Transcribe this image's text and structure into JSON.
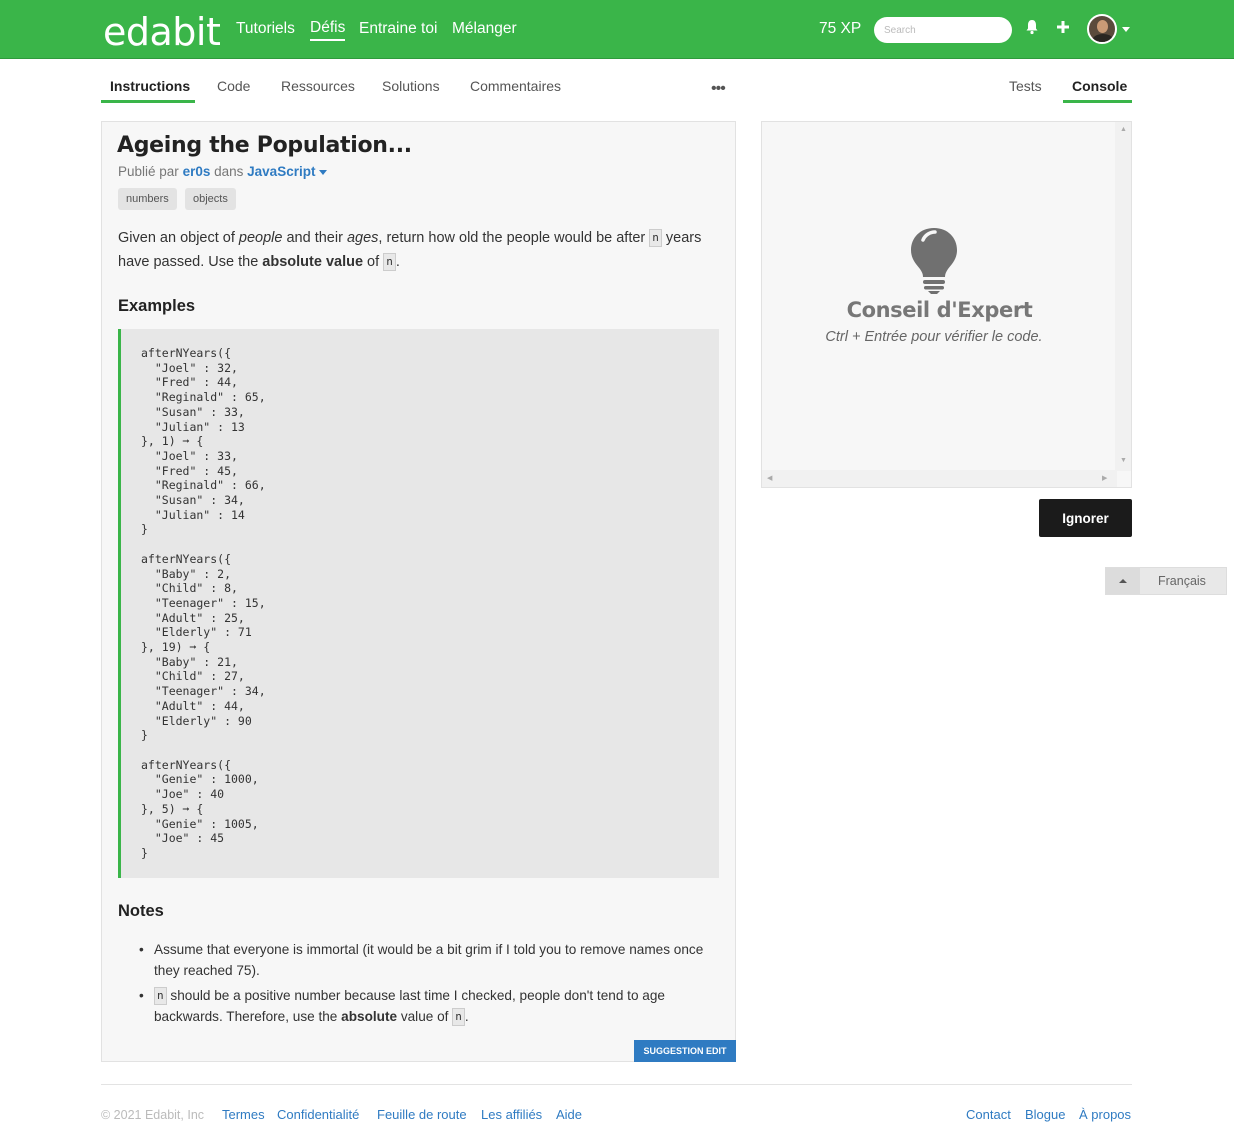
{
  "header": {
    "logo": "edabit",
    "nav": [
      "Tutoriels",
      "Défis",
      "Entraine toi",
      "Mélanger"
    ],
    "active_nav": "Défis",
    "xp": "75 XP",
    "search_placeholder": "Search"
  },
  "tabs": {
    "left": [
      "Instructions",
      "Code",
      "Ressources",
      "Solutions",
      "Commentaires"
    ],
    "more": "•••",
    "right": [
      "Tests",
      "Console"
    ]
  },
  "challenge": {
    "title": "Ageing the Population...",
    "published_prefix": "Publié par",
    "author": "er0s",
    "in_word": "dans",
    "language": "JavaScript",
    "tags": [
      "numbers",
      "objects"
    ],
    "desc": {
      "p1": "Given an object of ",
      "people": "people",
      "p2": " and their ",
      "ages": "ages",
      "p3": ", return how old the people would be after ",
      "n": "n",
      "p4": " years have passed. Use the ",
      "abs": "absolute value",
      "p5": " of ",
      "p6": "."
    },
    "examples_heading": "Examples",
    "code": "afterNYears({\n  \"Joel\" : 32,\n  \"Fred\" : 44,\n  \"Reginald\" : 65,\n  \"Susan\" : 33,\n  \"Julian\" : 13\n}, 1) ➞ {\n  \"Joel\" : 33,\n  \"Fred\" : 45,\n  \"Reginald\" : 66,\n  \"Susan\" : 34,\n  \"Julian\" : 14\n}\n\nafterNYears({\n  \"Baby\" : 2,\n  \"Child\" : 8,\n  \"Teenager\" : 15,\n  \"Adult\" : 25,\n  \"Elderly\" : 71\n}, 19) ➞ {\n  \"Baby\" : 21,\n  \"Child\" : 27,\n  \"Teenager\" : 34,\n  \"Adult\" : 44,\n  \"Elderly\" : 90\n}\n\nafterNYears({\n  \"Genie\" : 1000,\n  \"Joe\" : 40\n}, 5) ➞ {\n  \"Genie\" : 1005,\n  \"Joe\" : 45\n}",
    "notes_heading": "Notes",
    "note1": "Assume that everyone is immortal (it would be a bit grim if I told you to remove names once they reached 75).",
    "note2": {
      "n": "n",
      "a": " should be a positive number because last time I checked, people don't tend to age backwards. Therefore, use the ",
      "abs": "absolute",
      "b": " value of ",
      "c": "."
    },
    "suggest_button": "SUGGESTION EDIT"
  },
  "console": {
    "tip_title": "Conseil d'Expert",
    "tip_text": "Ctrl + Entrée pour vérifier le code.",
    "ignore_button": "Ignorer"
  },
  "language_switch": "Français",
  "footer": {
    "copyright": "© 2021 Edabit, Inc",
    "links_left": [
      "Termes",
      "Confidentialité",
      "Feuille de route",
      "Les affiliés",
      "Aide"
    ],
    "links_right": [
      "Contact",
      "Blogue",
      "À propos"
    ]
  },
  "colors": {
    "brand": "#3ab549",
    "link": "#2f7bc2",
    "dark_button": "#1b1b1b"
  }
}
